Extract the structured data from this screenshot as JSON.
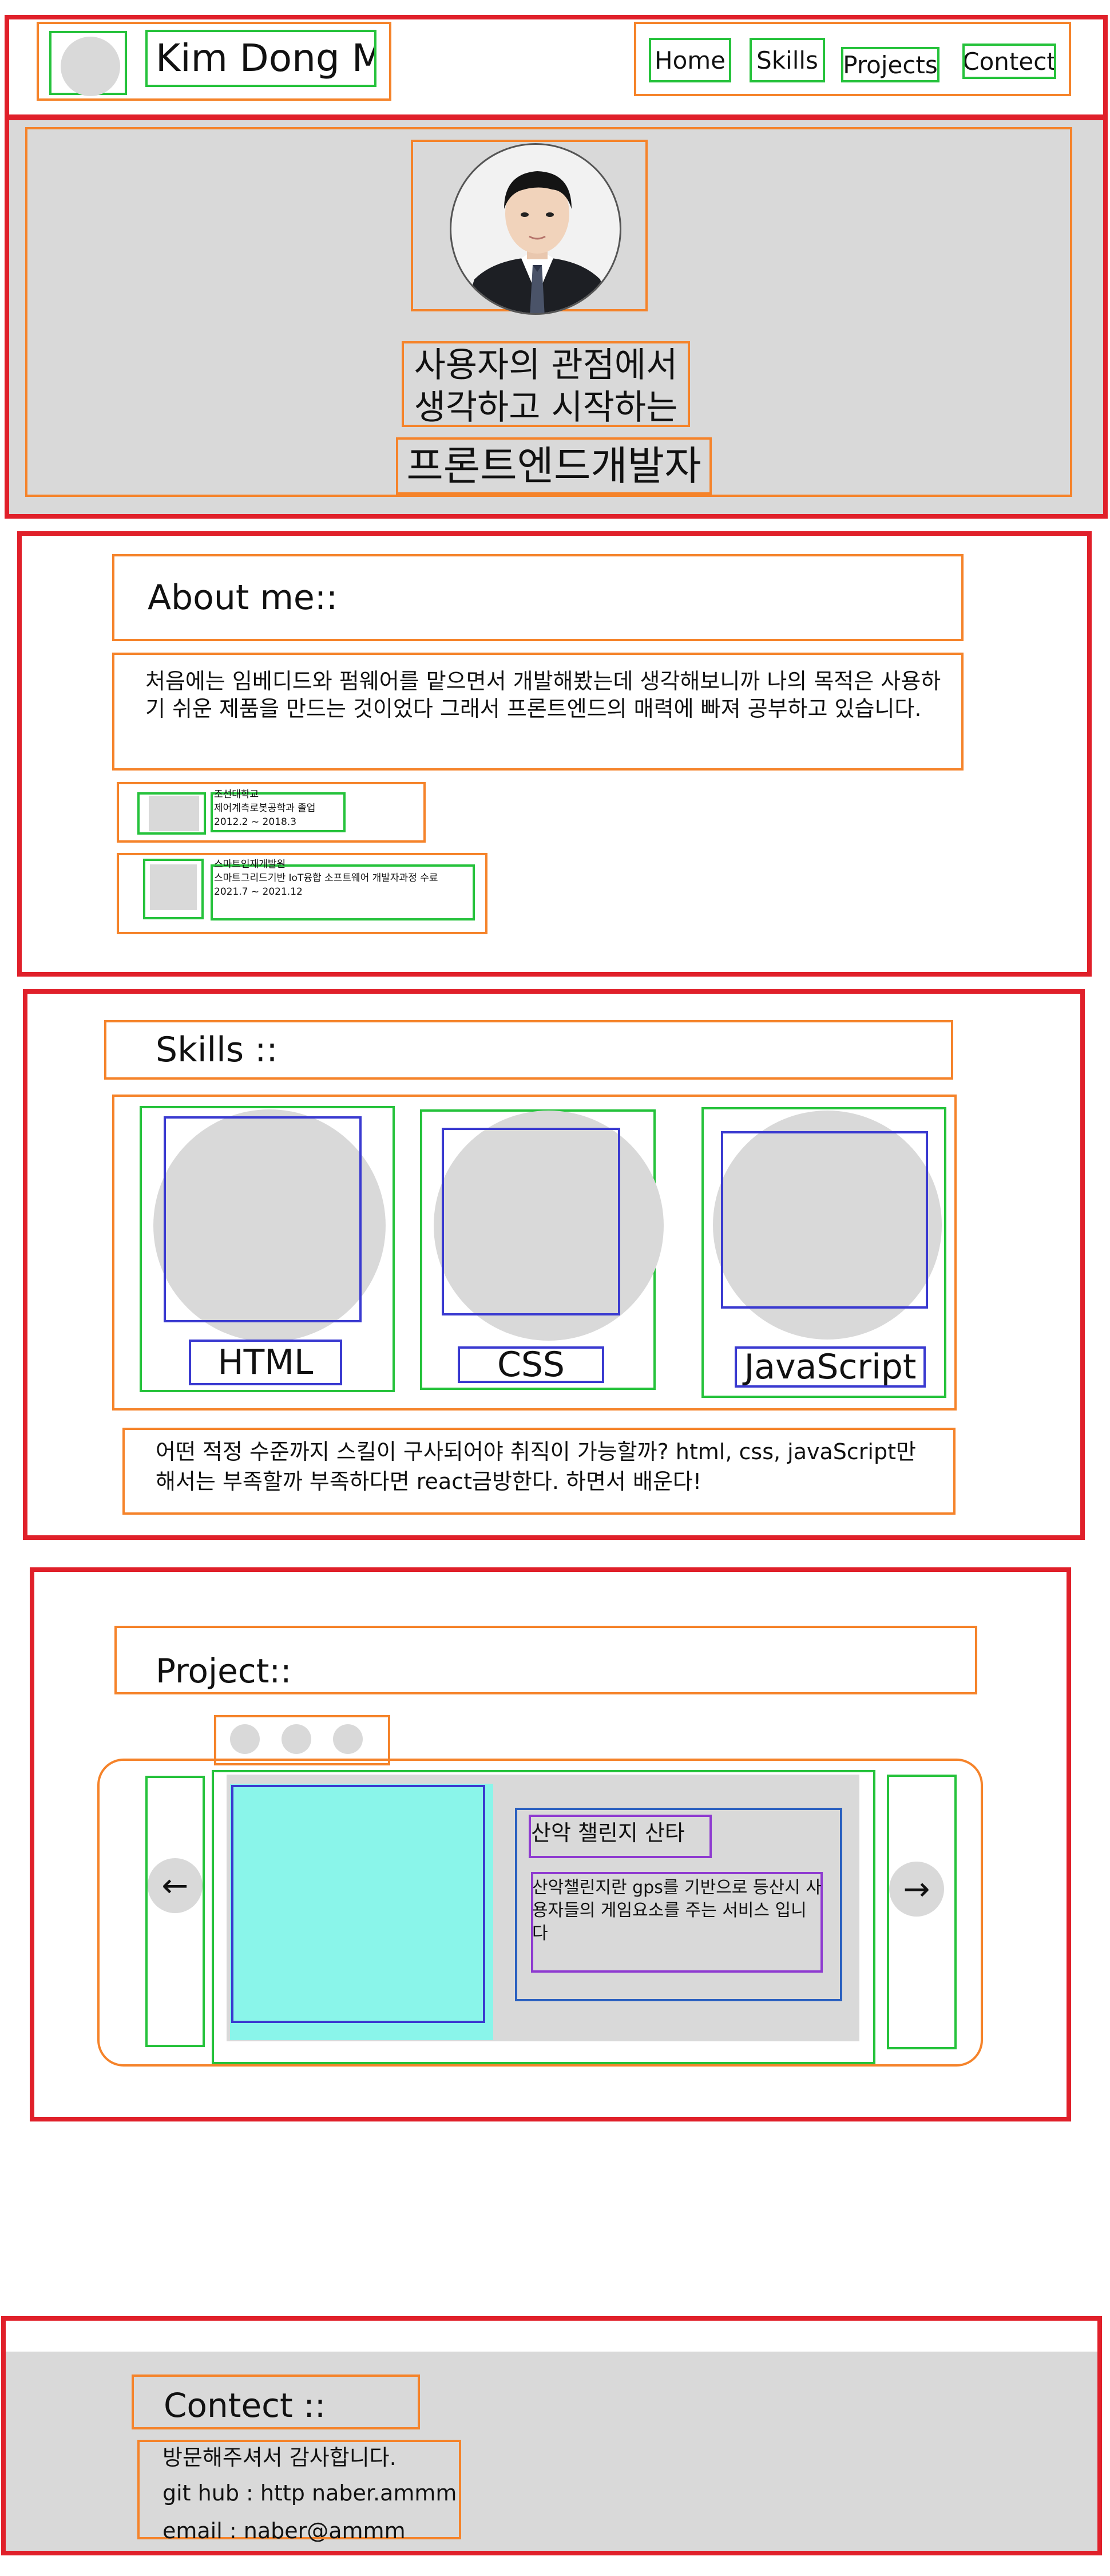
{
  "header": {
    "name": "Kim Dong Min",
    "nav": [
      "Home",
      "Skills",
      "Projects",
      "Contect"
    ]
  },
  "hero": {
    "line1": "사용자의 관점에서",
    "line2": "생각하고 시작하는",
    "line3": "프론트엔드개발자"
  },
  "about": {
    "title": "About me::",
    "description": "처음에는 임베디드와 펌웨어를 맡으면서 개발해봤는데 생각해보니까 나의 목적은 사용하기 쉬운 제품을 만드는 것이었다 그래서 프론트엔드의 매력에 빠져 공부하고 있습니다.",
    "history": [
      {
        "org": "조선대학교",
        "detail": "제어계측로봇공학과 졸업",
        "period": "2012.2 ~ 2018.3"
      },
      {
        "org": "스마트인재개발원",
        "detail": "스마트그리드기반 IoT융합 소프트웨어 개발자과정 수료",
        "period": "2021.7 ~ 2021.12"
      }
    ]
  },
  "skills": {
    "title": "Skills ::",
    "items": [
      "HTML",
      "CSS",
      "JavaScript"
    ],
    "description": "어떤 적정 수준까지 스킬이 구사되어야 취직이 가능할까? html, css, javaScript만 해서는 부족할까 부족하다면 react금방한다. 하면서 배운다!"
  },
  "project": {
    "title": "Project::",
    "prev": "←",
    "next": "→",
    "card_title": "산악 챌린지 산타",
    "card_desc": "산악챌린지란 gps를 기반으로 등산시 사용자들의 게임요소를 주는 서비스 입니다"
  },
  "contact": {
    "title": "Contect ::",
    "thanks": "방문해주셔서 감사합니다.",
    "github": "git hub : http naber.ammm",
    "email": "email : naber@ammm"
  },
  "colors": {
    "outline_red": "#e0202a",
    "outline_orange": "#f5832a",
    "outline_green": "#25c23b",
    "placeholder_gray": "#d9d9d9",
    "project_image": "#8af5ea"
  }
}
